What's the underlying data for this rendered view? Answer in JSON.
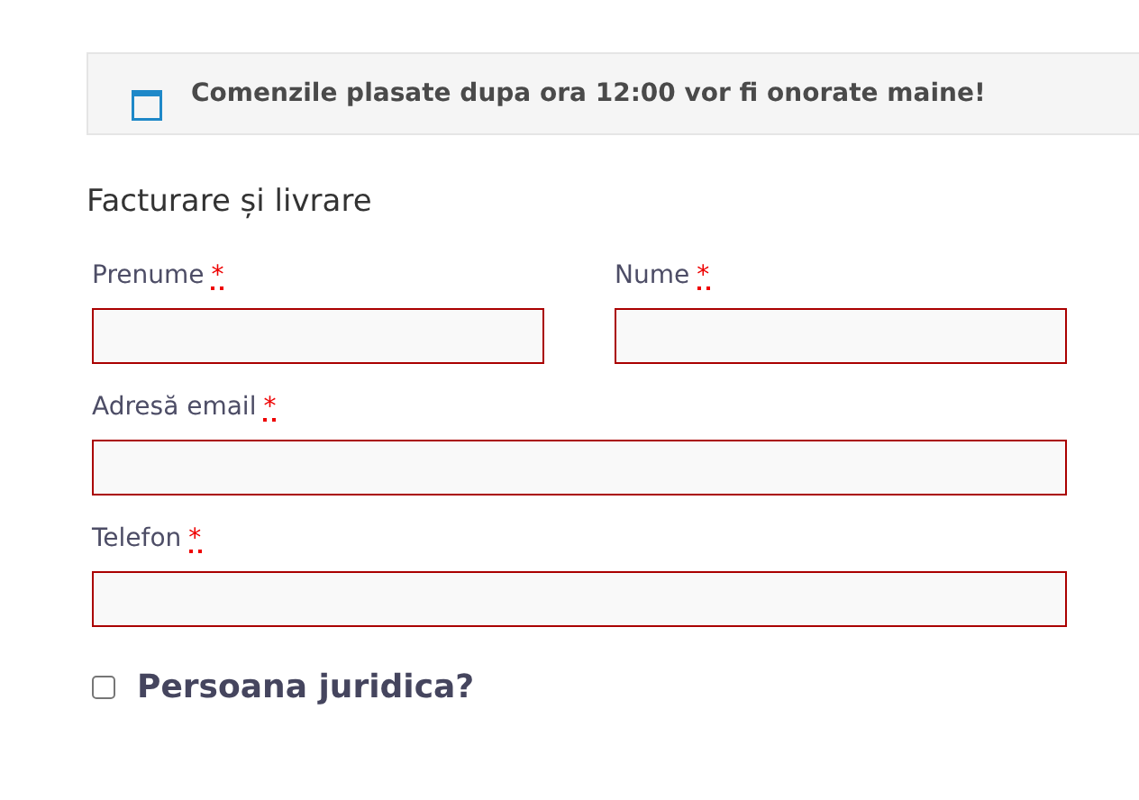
{
  "notice": {
    "text": "Comenzile plasate dupa ora 12:00 vor fi onorate maine!"
  },
  "section_title": "Facturare și livrare",
  "field_rows": [
    [
      {
        "label": "Prenume",
        "required_mark": "*",
        "invalid": true
      },
      {
        "label": "Nume",
        "required_mark": "*",
        "invalid": true
      }
    ],
    [
      {
        "label": "Adresă email",
        "required_mark": "*",
        "invalid": true
      }
    ],
    [
      {
        "label": "Telefon",
        "required_mark": "*",
        "invalid": true
      }
    ]
  ],
  "company_checkbox": {
    "label": "Persoana juridica?",
    "checked": false
  }
}
